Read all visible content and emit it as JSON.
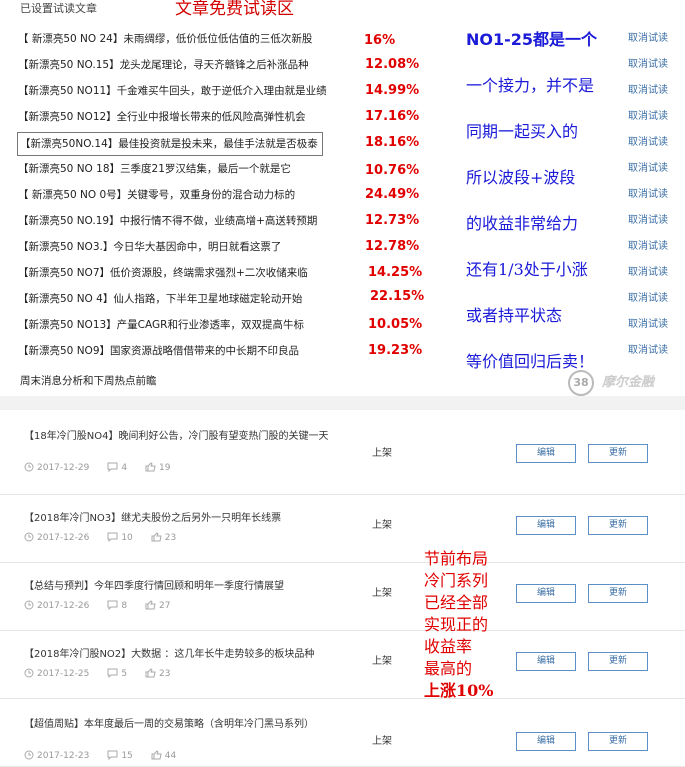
{
  "top_panel": {
    "title": "已设置试读文章",
    "banner": "文章免费试读区",
    "cancel_label": "取消试读",
    "articles": [
      {
        "title": "【 新漂亮50 NO 24】未雨绸缪，低价低位低估值的三低次新股",
        "pct": "16%"
      },
      {
        "title": "【新漂亮50 NO.15】龙头龙尾理论，寻天齐赣锋之后补涨品种",
        "pct": "12.08%"
      },
      {
        "title": "【新漂亮50 NO11】千金难买牛回头，敢于逆低介入理由就是业绩",
        "pct": "14.99%"
      },
      {
        "title": "【新漂亮50 NO12】全行业中报增长带来的低风险高弹性机会",
        "pct": "17.16%"
      },
      {
        "title": "【新漂亮50NO.14】最佳投资就是投未来，最佳手法就是否极泰",
        "pct": "18.16%"
      },
      {
        "title": "【新漂亮50 NO 18】三季度21罗汉结集，最后一个就是它",
        "pct": "10.76%"
      },
      {
        "title": "【 新漂亮50 NO 0号】关键零号，双重身份的混合动力标的",
        "pct": "24.49%"
      },
      {
        "title": "【新漂亮50 NO.19】中报行情不得不做，业绩高增+高送转预期",
        "pct": "12.73%"
      },
      {
        "title": "【新漂亮50 NO3.】今日华大基因命中，明日就看这票了",
        "pct": "12.78%"
      },
      {
        "title": "【新漂亮50 NO7】低价资源股，终端需求强烈+二次收储来临",
        "pct": "14.25%"
      },
      {
        "title": "【新漂亮50 NO 4】仙人指路，下半年卫星地球磁定轮动开始",
        "pct": "22.15%"
      },
      {
        "title": "【新漂亮50 NO13】产量CAGR和行业渗透率，双双提高牛标",
        "pct": "10.05%"
      },
      {
        "title": "【新漂亮50 NO9】国家资源战略借借带来的中长期不印良品",
        "pct": "19.23%"
      }
    ],
    "weekend_link": "周末消息分析和下周热点前瞻",
    "blue_note": [
      "NO1-25都是一个",
      "一个接力，并不是",
      "同期一起买入的",
      "所以波段+波段",
      "的收益非常给力",
      "还有1/3处于小涨",
      "或者持平状态",
      "等价值回归后卖！"
    ],
    "logo_text": "摩尔金融"
  },
  "list": {
    "edit_label": "编辑",
    "update_label": "更新",
    "rows": [
      {
        "title": "【18年冷门股NO4】晚间利好公告，冷门股有望变热门股的关键一天",
        "date": "2017-12-29",
        "comments": "4",
        "likes": "19",
        "status": "上架"
      },
      {
        "title": "【2018年冷门NO3】继尤夫股份之后另外一只明年长线票",
        "date": "2017-12-26",
        "comments": "10",
        "likes": "23",
        "status": "上架"
      },
      {
        "title": "【总结与预判】今年四季度行情回顾和明年一季度行情展望",
        "date": "2017-12-26",
        "comments": "8",
        "likes": "27",
        "status": "上架"
      },
      {
        "title": "【2018年冷门股NO2】大数据 ：这几年长牛走势较多的板块品种",
        "date": "2017-12-25",
        "comments": "5",
        "likes": "23",
        "status": "上架"
      },
      {
        "title": "【超值周贴】本年度最后一周的交易策略（含明年冷门黑马系列）",
        "date": "2017-12-23",
        "comments": "15",
        "likes": "44",
        "status": "上架"
      }
    ]
  },
  "red_note": [
    "节前布局",
    "冷门系列",
    "已经全部",
    "实现正的",
    "收益率",
    "最高的",
    "上涨10%"
  ]
}
